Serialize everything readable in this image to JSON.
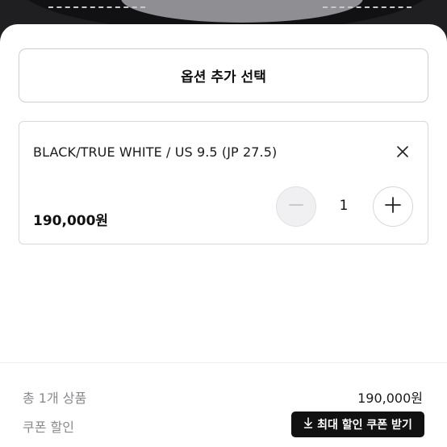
{
  "sheet": {
    "option_select_label": "옵션 추가 선택"
  },
  "item": {
    "name": "BLACK/TRUE WHITE / US 9.5 (JP 27.5)",
    "price": "190,000원",
    "quantity": "1",
    "icons": {
      "close": "close-icon",
      "minus": "minus-icon",
      "plus": "plus-icon"
    }
  },
  "summary": {
    "count_label": "총 1개 상품",
    "total_price": "190,000원",
    "coupon_label": "쿠폰 할인",
    "coupon_button_label": "최대 할인 쿠폰 받기",
    "coupon_button_icon": "download-icon"
  },
  "colors": {
    "primary_dark": "#111111",
    "muted_text": "#8a8a8f",
    "border": "#d9d9dc"
  }
}
